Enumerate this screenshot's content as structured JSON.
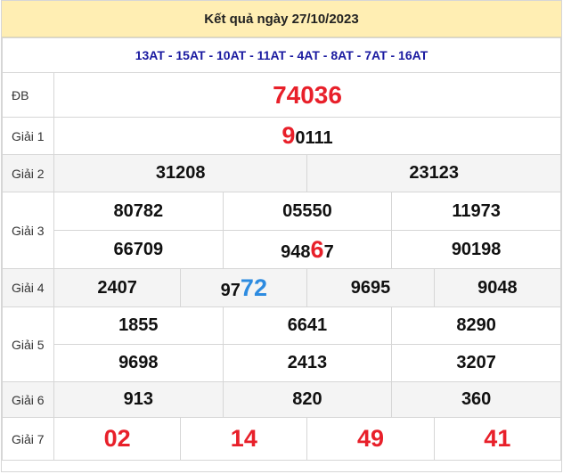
{
  "title": "Kết quả ngày 27/10/2023",
  "codes": "13AT - 15AT - 10AT - 11AT - 4AT - 8AT - 7AT - 16AT",
  "rows": {
    "db": {
      "label": "ĐB",
      "value": "74036"
    },
    "g1": {
      "label": "Giải 1",
      "prefix": "9",
      "rest": "0111"
    },
    "g2": {
      "label": "Giải 2",
      "values": [
        "31208",
        "23123"
      ]
    },
    "g3": {
      "label": "Giải 3",
      "row1": [
        "80782",
        "05550",
        "11973"
      ],
      "row2_a": "66709",
      "row2_b_pre": "948",
      "row2_b_hl": "6",
      "row2_b_post": "7",
      "row2_c": "90198"
    },
    "g4": {
      "label": "Giải 4",
      "a": "2407",
      "b_pre": "97",
      "b_hl": "72",
      "c": "9695",
      "d": "9048"
    },
    "g5": {
      "label": "Giải 5",
      "row1": [
        "1855",
        "6641",
        "8290"
      ],
      "row2": [
        "9698",
        "2413",
        "3207"
      ]
    },
    "g6": {
      "label": "Giải 6",
      "values": [
        "913",
        "820",
        "360"
      ]
    },
    "g7": {
      "label": "Giải 7",
      "values": [
        "02",
        "14",
        "49",
        "41"
      ]
    }
  },
  "colors": {
    "header_bg": "#ffeeb3",
    "highlight_red": "#e8202a",
    "highlight_blue": "#2d8be0",
    "codes_blue": "#1a1aa0"
  }
}
